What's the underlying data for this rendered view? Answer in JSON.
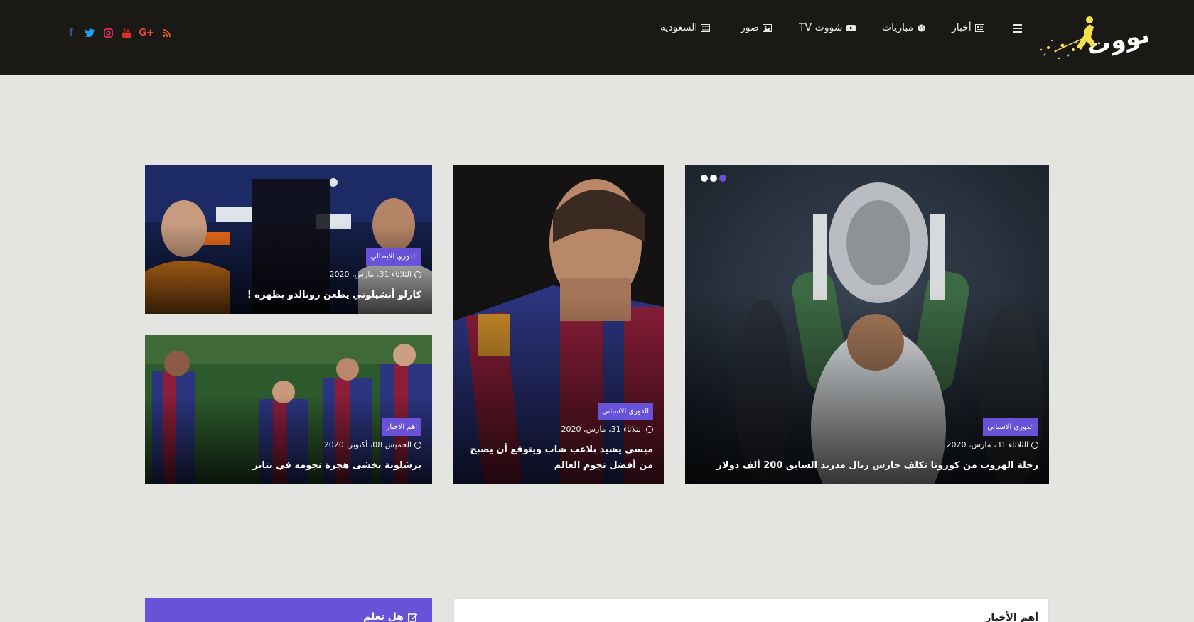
{
  "site": {
    "logo_text": "شووت"
  },
  "nav": {
    "news": "أخبار",
    "matches": "مباريات",
    "tv": "شووت TV",
    "photos": "صور",
    "saudi": "السعودية"
  },
  "socials": [
    "facebook-icon",
    "twitter-icon",
    "instagram-icon",
    "youtube-icon",
    "google-plus-icon",
    "rss-icon"
  ],
  "colors": {
    "accent": "#6752d8",
    "header_bg": "#1a1915",
    "page_bg": "#e4e4e0"
  },
  "slider": {
    "active_index": 2,
    "count": 3
  },
  "cards": [
    {
      "category": "الدوري الاسباني",
      "date": "الثلاثاء 31، مارس، 2020",
      "title": "رحلة الهروب من كورونا تكلف حارس ريال مدريد السابق 200 ألف دولار"
    },
    {
      "category": "الدوري الاسباني",
      "date": "الثلاثاء 31، مارس، 2020",
      "title": "ميسي يشيد بلاعب شاب ويتوقع أن يصبح من أفضل نجوم العالم"
    },
    {
      "category": "الدوري الايطالي",
      "date": "الثلاثاء 31، مارس، 2020",
      "title": "كارلو أنشيلوتي يطعن رونالدو بظهره !"
    },
    {
      "category": "اهم الاخبار",
      "date": "الخميس 08، أكتوبر، 2020",
      "title": "برشلونة يخشى هجرة نجومه في يناير"
    }
  ],
  "boxes": {
    "did_you_know": "هل تعلم",
    "top_news": "أهم الأخبار"
  }
}
